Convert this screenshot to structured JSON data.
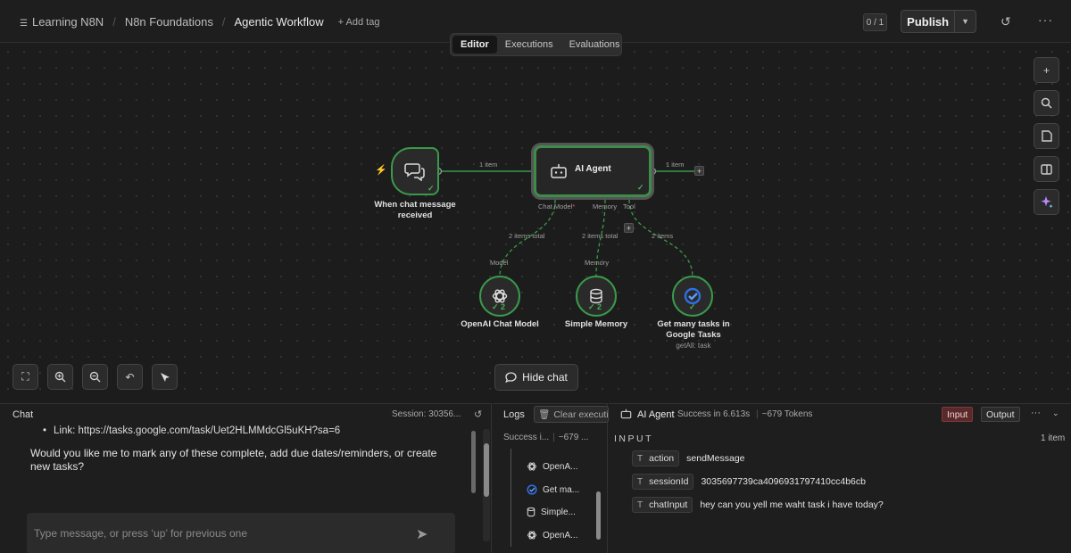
{
  "header": {
    "breadcrumbs": [
      "Learning N8N",
      "N8n Foundations",
      "Agentic Workflow"
    ],
    "add_tag": "+ Add tag",
    "counter": "0 / 1",
    "publish_label": "Publish"
  },
  "mode_tabs": [
    "Editor",
    "Executions",
    "Evaluations"
  ],
  "canvas": {
    "trigger_node": {
      "label_line1": "When chat message",
      "label_line2": "received"
    },
    "agent_node": {
      "label": "AI Agent"
    },
    "main_wire_label_in": "1 item",
    "main_wire_label_out": "1 item",
    "ports": {
      "chat_model": "Chat Model",
      "required_marker": "*",
      "memory": "Memory",
      "tool": "Tool"
    },
    "sub_wire_labels": [
      "2 items total",
      "2 items total",
      "2 items"
    ],
    "sub_inputs": {
      "model": "Model",
      "memory": "Memory"
    },
    "sub_nodes": [
      {
        "label": "OpenAI Chat Model",
        "count": "2",
        "icon": "openai-icon"
      },
      {
        "label": "Simple Memory",
        "count": "2",
        "icon": "database-icon"
      },
      {
        "label_line1": "Get many tasks in",
        "label_line2": "Google Tasks",
        "sub": "getAll: task",
        "icon": "google-tasks-icon"
      }
    ],
    "hide_chat_label": "Hide chat",
    "accent_green": "#3a9a4a"
  },
  "chat": {
    "title": "Chat",
    "session": "Session: 30356...",
    "link_text": "Link: https://tasks.google.com/task/Uet2HLMMdcGl5uKH?sa=6",
    "message": "Would you like me to mark any of these complete, add due dates/reminders, or create new tasks?",
    "input_placeholder": "Type message, or press ‘up’ for previous one"
  },
  "logs": {
    "title": "Logs",
    "clear_label": "Clear executi",
    "summary_status": "Success i...",
    "summary_tokens": "~679 ...",
    "items": [
      "OpenA...",
      "Get ma...",
      "Simple...",
      "OpenA..."
    ]
  },
  "agent_panel": {
    "title": "AI Agent",
    "status": "Success in 6.613s",
    "tokens": "~679 Tokens",
    "input_btn": "Input",
    "output_btn": "Output",
    "section_label": "INPUT",
    "items_count": "1 item",
    "fields": [
      {
        "key": "action",
        "value": "sendMessage"
      },
      {
        "key": "sessionId",
        "value": "3035697739ca4096931797410cc4b6cb"
      },
      {
        "key": "chatInput",
        "value": "hey can you yell me waht task i have today?"
      }
    ]
  }
}
